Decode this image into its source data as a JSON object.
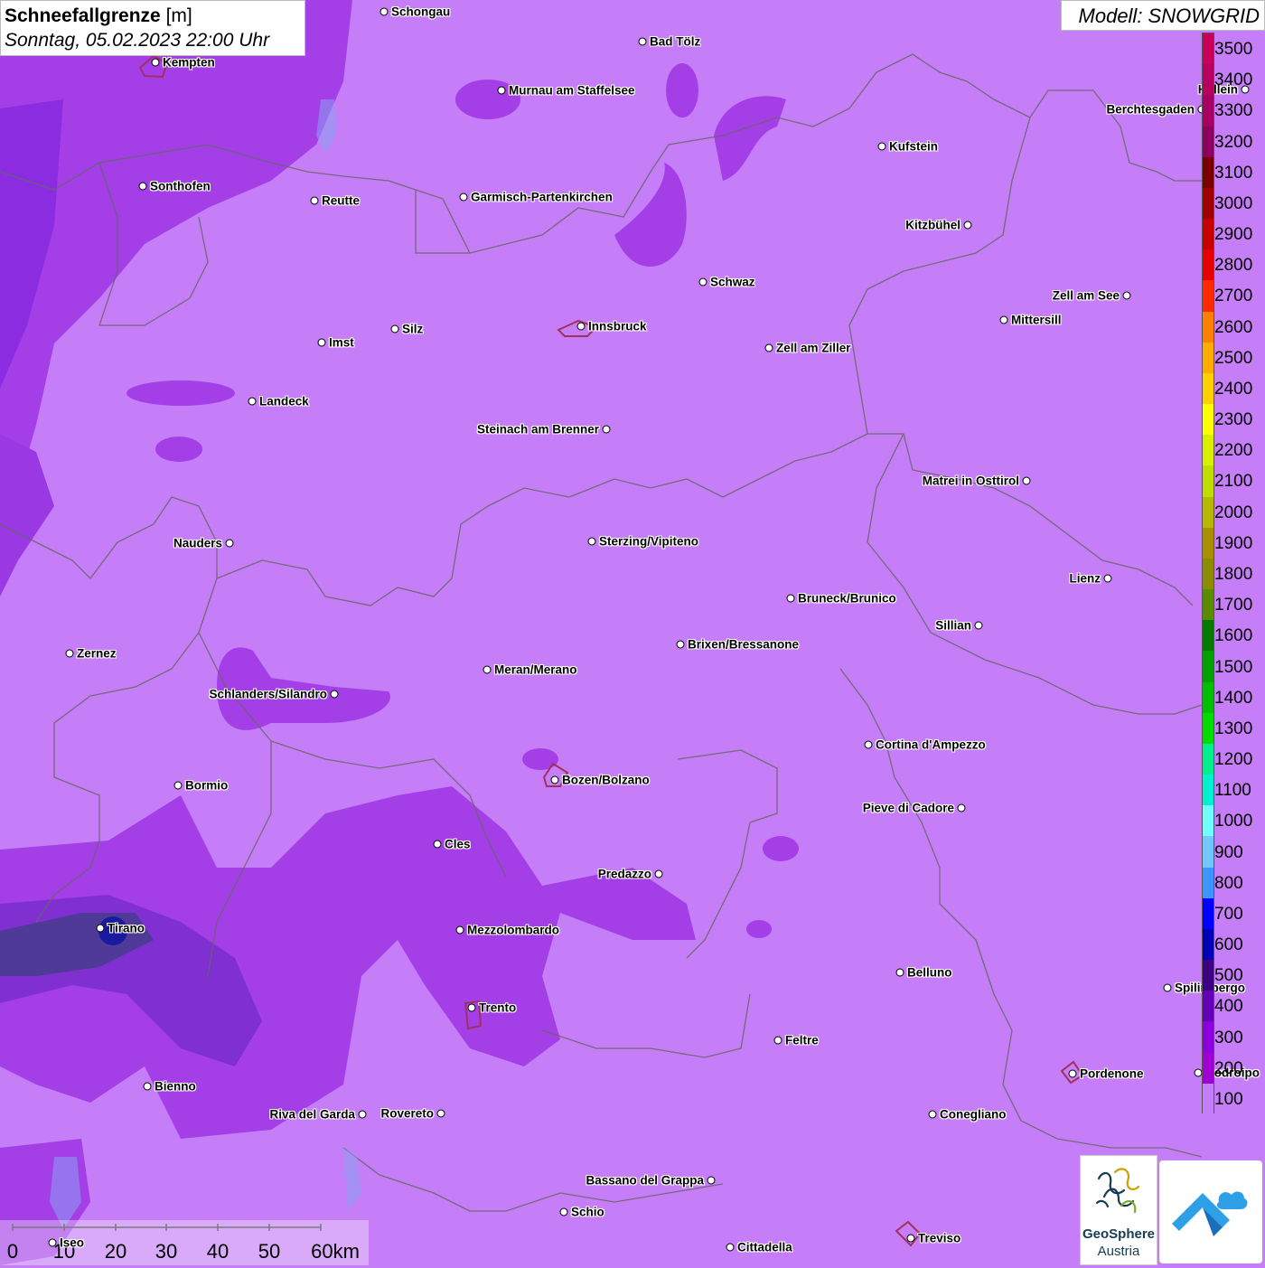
{
  "title": {
    "name": "Schneefallgrenze",
    "unit": "[m]",
    "datetime": "Sonntag, 05.02.2023 22:00 Uhr"
  },
  "model": "Modell: SNOWGRID",
  "legend": {
    "labels": [
      "3500",
      "3400",
      "3300",
      "3200",
      "3100",
      "3000",
      "2900",
      "2800",
      "2700",
      "2600",
      "2500",
      "2400",
      "2300",
      "2200",
      "2100",
      "2000",
      "1900",
      "1800",
      "1700",
      "1600",
      "1500",
      "1400",
      "1300",
      "1200",
      "1100",
      "1000",
      "900",
      "800",
      "700",
      "600",
      "500",
      "400",
      "300",
      "200",
      "100"
    ],
    "colors": [
      "#c8005a",
      "#b8005e",
      "#a80062",
      "#8c0060",
      "#7a0000",
      "#a00000",
      "#c80000",
      "#e60000",
      "#ff2a00",
      "#ff8000",
      "#ffab00",
      "#ffd000",
      "#ffff00",
      "#d8f000",
      "#c0dc00",
      "#b4b800",
      "#a89000",
      "#8c8c00",
      "#5a8c00",
      "#007a00",
      "#00a000",
      "#00be00",
      "#00dc00",
      "#00f090",
      "#00f0d0",
      "#70ffff",
      "#70c8ff",
      "#3c96ff",
      "#0000ff",
      "#0000b4",
      "#3c0080",
      "#6400b4",
      "#8c00dc",
      "#a000d2",
      "#c67df8"
    ]
  },
  "cities": [
    {
      "name": "Schongau"
    },
    {
      "name": "Bad Tölz"
    },
    {
      "name": "Kempten"
    },
    {
      "name": "Murnau am Staffelsee"
    },
    {
      "name": "Hallein"
    },
    {
      "name": "Berchtesgaden"
    },
    {
      "name": "Kufstein"
    },
    {
      "name": "Sonthofen"
    },
    {
      "name": "Reutte"
    },
    {
      "name": "Garmisch-Partenkirchen"
    },
    {
      "name": "Kitzbühel"
    },
    {
      "name": "Schwaz"
    },
    {
      "name": "Zell am See"
    },
    {
      "name": "Innsbruck"
    },
    {
      "name": "Mittersill"
    },
    {
      "name": "Silz"
    },
    {
      "name": "Imst"
    },
    {
      "name": "Zell am Ziller"
    },
    {
      "name": "Landeck"
    },
    {
      "name": "Steinach am Brenner"
    },
    {
      "name": "Matrei in Osttirol"
    },
    {
      "name": "Nauders"
    },
    {
      "name": "Sterzing/Vipiteno"
    },
    {
      "name": "Lienz"
    },
    {
      "name": "Bruneck/Brunico"
    },
    {
      "name": "Sillian"
    },
    {
      "name": "Brixen/Bressanone"
    },
    {
      "name": "Zernez"
    },
    {
      "name": "Meran/Merano"
    },
    {
      "name": "Schlanders/Silandro"
    },
    {
      "name": "Cortina d'Ampezzo"
    },
    {
      "name": "Bozen/Bolzano"
    },
    {
      "name": "Bormio"
    },
    {
      "name": "Pieve di Cadore"
    },
    {
      "name": "Cles"
    },
    {
      "name": "Predazzo"
    },
    {
      "name": "Tirano"
    },
    {
      "name": "Mezzolombardo"
    },
    {
      "name": "Belluno"
    },
    {
      "name": "Spilimbergo"
    },
    {
      "name": "Trento"
    },
    {
      "name": "Feltre"
    },
    {
      "name": "Pordenone"
    },
    {
      "name": "Codroipo"
    },
    {
      "name": "Bienno"
    },
    {
      "name": "Riva del Garda"
    },
    {
      "name": "Rovereto"
    },
    {
      "name": "Conegliano"
    },
    {
      "name": "Bassano del Grappa"
    },
    {
      "name": "Schio"
    },
    {
      "name": "Treviso"
    },
    {
      "name": "Iseo"
    },
    {
      "name": "Cittadella"
    }
  ],
  "scale": {
    "labels": [
      "0",
      "10",
      "20",
      "30",
      "40",
      "50",
      "60km"
    ]
  },
  "logos": {
    "geosphere_line1": "GeoSphere",
    "geosphere_line2": "Austria"
  }
}
